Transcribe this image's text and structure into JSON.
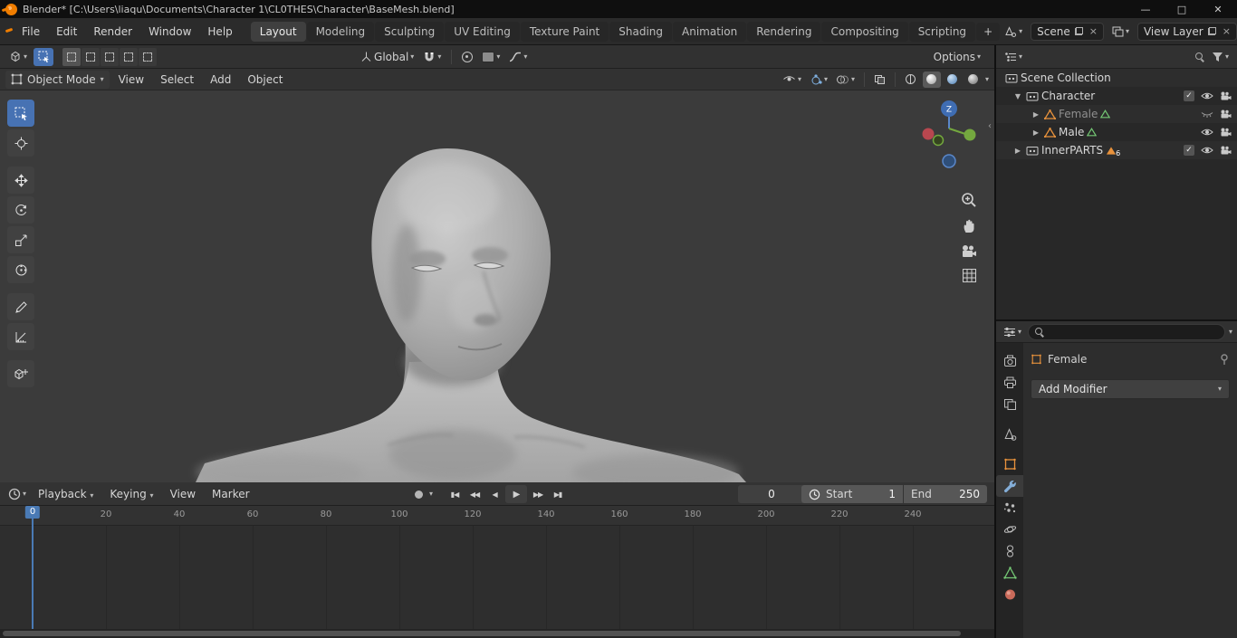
{
  "titlebar": {
    "title": "Blender* [C:\\Users\\liaqu\\Documents\\Character 1\\CL0THES\\Character\\BaseMesh.blend]",
    "controls": {
      "minimize": "—",
      "maximize": "□",
      "close": "✕"
    }
  },
  "icons": {
    "chevron_down": "▾",
    "disclosure_open": "▼",
    "disclosure_closed": "▶",
    "check": "✓",
    "close": "×"
  },
  "topbar": {
    "menus": [
      "File",
      "Edit",
      "Render",
      "Window",
      "Help"
    ],
    "workspaces": [
      "Layout",
      "Modeling",
      "Sculpting",
      "UV Editing",
      "Texture Paint",
      "Shading",
      "Animation",
      "Rendering",
      "Compositing",
      "Scripting"
    ],
    "active_workspace": "Layout",
    "add_workspace": "+",
    "scene_value": "Scene",
    "view_layer_value": "View Layer"
  },
  "tool_settings": {
    "orientation_value": "Global",
    "options_label": "Options"
  },
  "viewport": {
    "mode_value": "Object Mode",
    "menus": [
      "View",
      "Select",
      "Add",
      "Object"
    ],
    "gizmo_z": "Z"
  },
  "outliner": {
    "rows": [
      {
        "label": "Scene Collection"
      },
      {
        "label": "Character"
      },
      {
        "label": "Female"
      },
      {
        "label": "Male"
      },
      {
        "label": "InnerPARTS",
        "badge": "6"
      }
    ]
  },
  "properties": {
    "active_object": "Female",
    "add_modifier_label": "Add Modifier"
  },
  "timeline": {
    "menus": [
      "Playback",
      "Keying",
      "View",
      "Marker"
    ],
    "transport": [
      "▮◀",
      "◀◀",
      "◀",
      "▶",
      "▶▶",
      "▶▮"
    ],
    "current_frame": "0",
    "playhead_label": "0",
    "start_label": "Start",
    "start_value": "1",
    "end_label": "End",
    "end_value": "250",
    "ticks": [
      "20",
      "40",
      "60",
      "80",
      "100",
      "120",
      "140",
      "160",
      "180",
      "200",
      "220",
      "240"
    ]
  },
  "colors": {
    "accent_blue": "#4772b3",
    "object_orange": "#e8923c",
    "mesh_green": "#74c774",
    "logo_orange": "#ef7d00"
  }
}
